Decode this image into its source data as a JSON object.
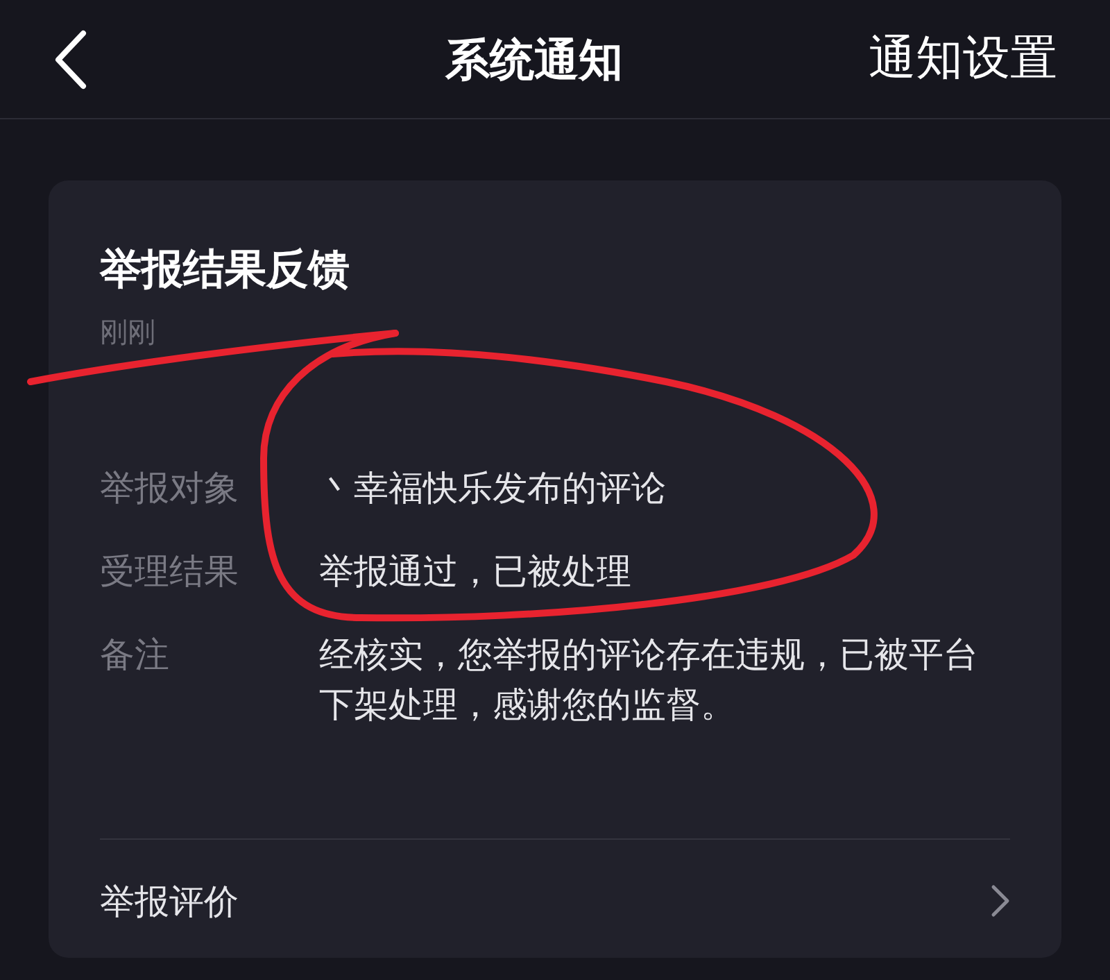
{
  "header": {
    "title": "系统通知",
    "action": "通知设置"
  },
  "card": {
    "title": "举报结果反馈",
    "time": "刚刚",
    "fields": [
      {
        "label": "举报对象",
        "value": "丶幸福快乐发布的评论"
      },
      {
        "label": "受理结果",
        "value": "举报通过，已被处理"
      },
      {
        "label": "备注",
        "value": "经核实，您举报的评论存在违规，已被平台下架处理，感谢您的监督。"
      }
    ],
    "footer_link": "举报评价"
  },
  "annotation": {
    "kind": "freehand"
  }
}
